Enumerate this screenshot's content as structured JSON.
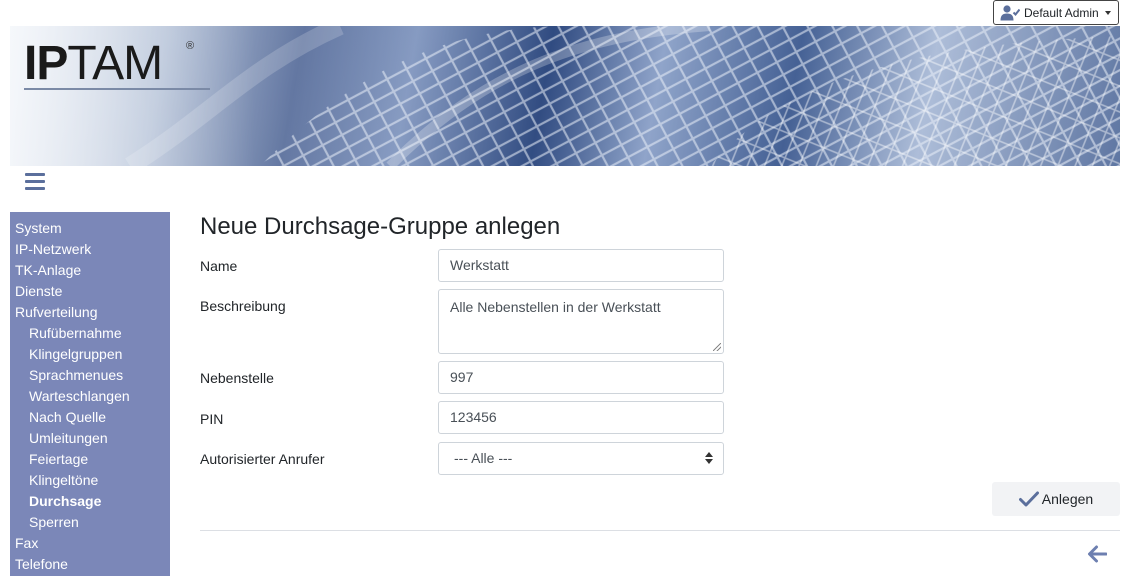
{
  "user_menu": {
    "label": "Default Admin",
    "icon": "user-check-icon"
  },
  "banner": {
    "logo_text_bold": "IP",
    "logo_text": "TAM",
    "logo_mark": "®"
  },
  "menu_toggle": {
    "icon": "hamburger-icon"
  },
  "sidebar": {
    "items": [
      {
        "label": "System",
        "level": 0,
        "active": false
      },
      {
        "label": "IP-Netzwerk",
        "level": 0,
        "active": false
      },
      {
        "label": "TK-Anlage",
        "level": 0,
        "active": false
      },
      {
        "label": "Dienste",
        "level": 0,
        "active": false
      },
      {
        "label": "Rufverteilung",
        "level": 0,
        "active": false
      },
      {
        "label": "Rufübernahme",
        "level": 1,
        "active": false
      },
      {
        "label": "Klingelgruppen",
        "level": 1,
        "active": false
      },
      {
        "label": "Sprachmenues",
        "level": 1,
        "active": false
      },
      {
        "label": "Warteschlangen",
        "level": 1,
        "active": false
      },
      {
        "label": "Nach Quelle",
        "level": 1,
        "active": false
      },
      {
        "label": "Umleitungen",
        "level": 1,
        "active": false
      },
      {
        "label": "Feiertage",
        "level": 1,
        "active": false
      },
      {
        "label": "Klingeltöne",
        "level": 1,
        "active": false
      },
      {
        "label": "Durchsage",
        "level": 1,
        "active": true
      },
      {
        "label": "Sperren",
        "level": 1,
        "active": false
      },
      {
        "label": "Fax",
        "level": 0,
        "active": false
      },
      {
        "label": "Telefone",
        "level": 0,
        "active": false
      }
    ]
  },
  "main": {
    "title": "Neue Durchsage-Gruppe anlegen",
    "form": {
      "name": {
        "label": "Name",
        "value": "Werkstatt"
      },
      "description": {
        "label": "Beschreibung",
        "value": "Alle Nebenstellen in der Werkstatt"
      },
      "extension": {
        "label": "Nebenstelle",
        "value": "997"
      },
      "pin": {
        "label": "PIN",
        "value": "123456"
      },
      "authorized_caller": {
        "label": "Autorisierter Anrufer",
        "value": "--- Alle ---"
      }
    },
    "create_button": {
      "label": "Anlegen",
      "icon": "check-icon"
    },
    "back_button": {
      "icon": "arrow-left-icon"
    }
  },
  "colors": {
    "sidebar_bg": "#7b87b8",
    "accent": "#5b6f9c"
  }
}
